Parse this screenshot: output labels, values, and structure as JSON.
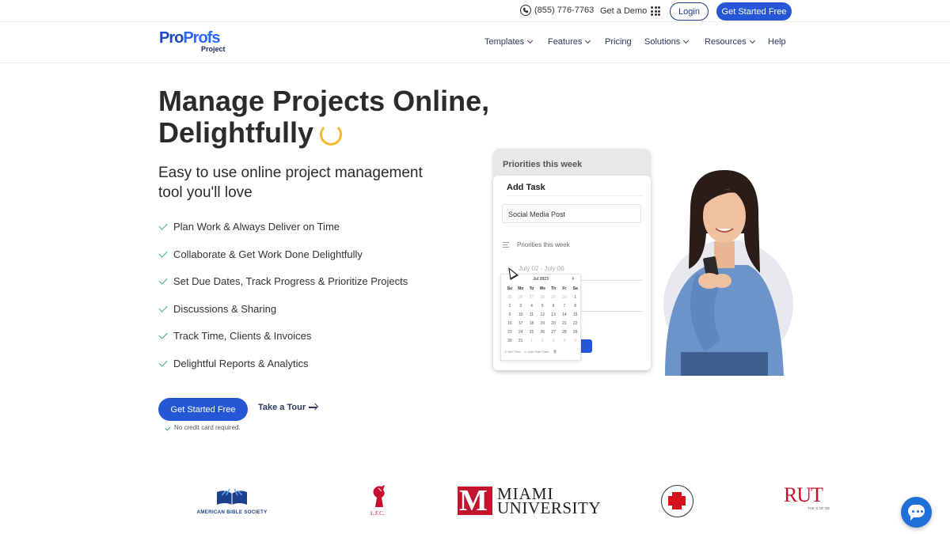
{
  "topbar": {
    "phone": "(855) 776-7763",
    "demo_label": "Get a Demo",
    "login_label": "Login",
    "start_label": "Get Started Free"
  },
  "logo": {
    "brand_part1": "Pro",
    "brand_part2": "Profs",
    "product": "Project"
  },
  "nav": {
    "items": [
      {
        "label": "Templates",
        "has_dropdown": true
      },
      {
        "label": "Features",
        "has_dropdown": true
      },
      {
        "label": "Pricing",
        "has_dropdown": false
      },
      {
        "label": "Solutions",
        "has_dropdown": true
      },
      {
        "label": "Resources",
        "has_dropdown": true
      },
      {
        "label": "Help",
        "has_dropdown": false
      }
    ]
  },
  "hero": {
    "title_line1": "Manage Projects Online,",
    "title_line2": "Delightfully",
    "subtitle": "Easy to use online project management tool you'll love",
    "features": [
      "Plan Work & Always Deliver on Time",
      "Collaborate & Get Work Done Delightfully",
      "Set Due Dates, Track Progress & Prioritize Projects",
      "Discussions & Sharing",
      "Track Time, Clients & Invoices",
      "Delightful Reports & Analytics"
    ],
    "cta_primary": "Get Started Free",
    "cta_secondary": "Take a Tour",
    "note": "No credit card required."
  },
  "mockup": {
    "back_header": "Priorities this week",
    "card_title": "Add Task",
    "task_value": "Social Media Post",
    "list_label": "Priorities this week",
    "date_range": "July 02 - July 06",
    "calendar": {
      "month": "Jul 2023",
      "day_headers": [
        "Su",
        "Mo",
        "Tu",
        "We",
        "Th",
        "Fr",
        "Sa"
      ],
      "weeks": [
        [
          "25",
          "26",
          "27",
          "28",
          "29",
          "30",
          "1"
        ],
        [
          "2",
          "3",
          "4",
          "5",
          "6",
          "7",
          "8"
        ],
        [
          "9",
          "10",
          "11",
          "12",
          "13",
          "14",
          "15"
        ],
        [
          "16",
          "17",
          "18",
          "19",
          "20",
          "21",
          "22"
        ],
        [
          "23",
          "24",
          "25",
          "26",
          "27",
          "28",
          "29"
        ],
        [
          "30",
          "31",
          "1",
          "2",
          "3",
          "4",
          "5"
        ]
      ],
      "footer_set_time": "Set Time",
      "footer_add_start": "Add Start Date"
    }
  },
  "logos": {
    "abs": "AMERICAN BIBLE SOCIETY",
    "lfc": "L.F.C.",
    "miami_line1": "MIAMI",
    "miami_line2": "UNIVERSITY",
    "rut": "RUT",
    "rut_small": "THE S OF NE"
  },
  "colors": {
    "primary": "#2456d6",
    "brand_dark": "#1f47c4",
    "check": "#3aa876",
    "accent_smile": "#f5b82e"
  }
}
